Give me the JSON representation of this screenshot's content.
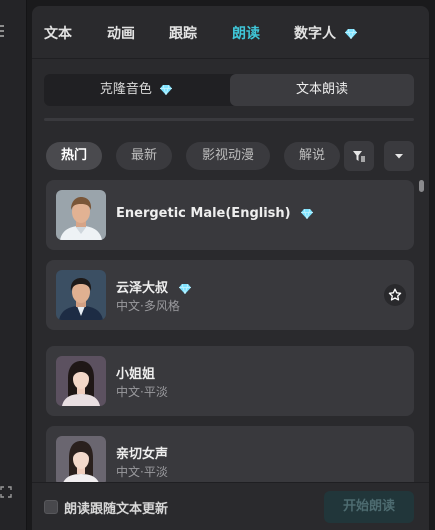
{
  "tabs": [
    {
      "label": "文本",
      "premium": false,
      "active": false
    },
    {
      "label": "动画",
      "premium": false,
      "active": false
    },
    {
      "label": "跟踪",
      "premium": false,
      "active": false
    },
    {
      "label": "朗读",
      "premium": false,
      "active": true
    },
    {
      "label": "数字人",
      "premium": true,
      "active": false
    }
  ],
  "mode_toggle": {
    "clone_label": "克隆音色",
    "clone_premium": true,
    "tts_label": "文本朗读",
    "selected": "文本朗读"
  },
  "filters": {
    "chips": [
      {
        "label": "热门",
        "active": true
      },
      {
        "label": "最新",
        "active": false
      },
      {
        "label": "影视动漫",
        "active": false
      },
      {
        "label": "解说",
        "active": false
      }
    ],
    "filter_icon": "filter-icon",
    "dropdown_icon": "caret-down-icon"
  },
  "voices": [
    {
      "name": "Energetic Male(English)",
      "subtitle": "",
      "premium": true,
      "favorite_visible": false
    },
    {
      "name": "云泽大叔",
      "subtitle": "中文·多风格",
      "premium": true,
      "favorite_visible": true
    },
    {
      "name": "小姐姐",
      "subtitle": "中文·平淡",
      "premium": false,
      "favorite_visible": false
    },
    {
      "name": "亲切女声",
      "subtitle": "中文·平淡",
      "premium": false,
      "favorite_visible": false
    }
  ],
  "footer": {
    "sync_checkbox_label": "朗读跟随文本更新",
    "sync_checked": false,
    "start_button_label": "开始朗读"
  },
  "colors": {
    "accent": "#3fc6d8",
    "panel_bg": "#2a2a2d",
    "card_bg": "#39393d",
    "start_button_disabled_bg": "#21363a"
  }
}
